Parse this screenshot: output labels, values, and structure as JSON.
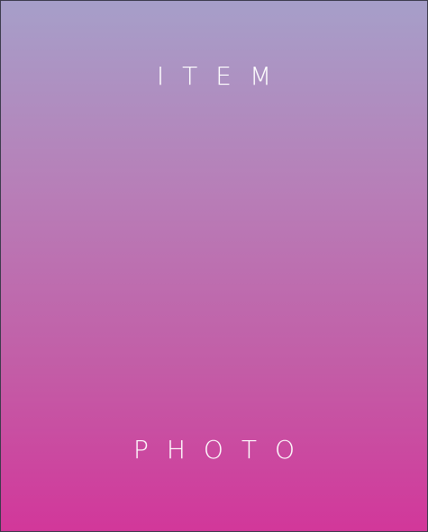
{
  "placeholder": {
    "top_text": "ITEM",
    "bottom_text": "PHOTO",
    "colors": {
      "gradient_top": "#a69fc9",
      "gradient_bottom": "#d2379a",
      "text": "#ffffff",
      "border": "#3a3a4a"
    }
  }
}
